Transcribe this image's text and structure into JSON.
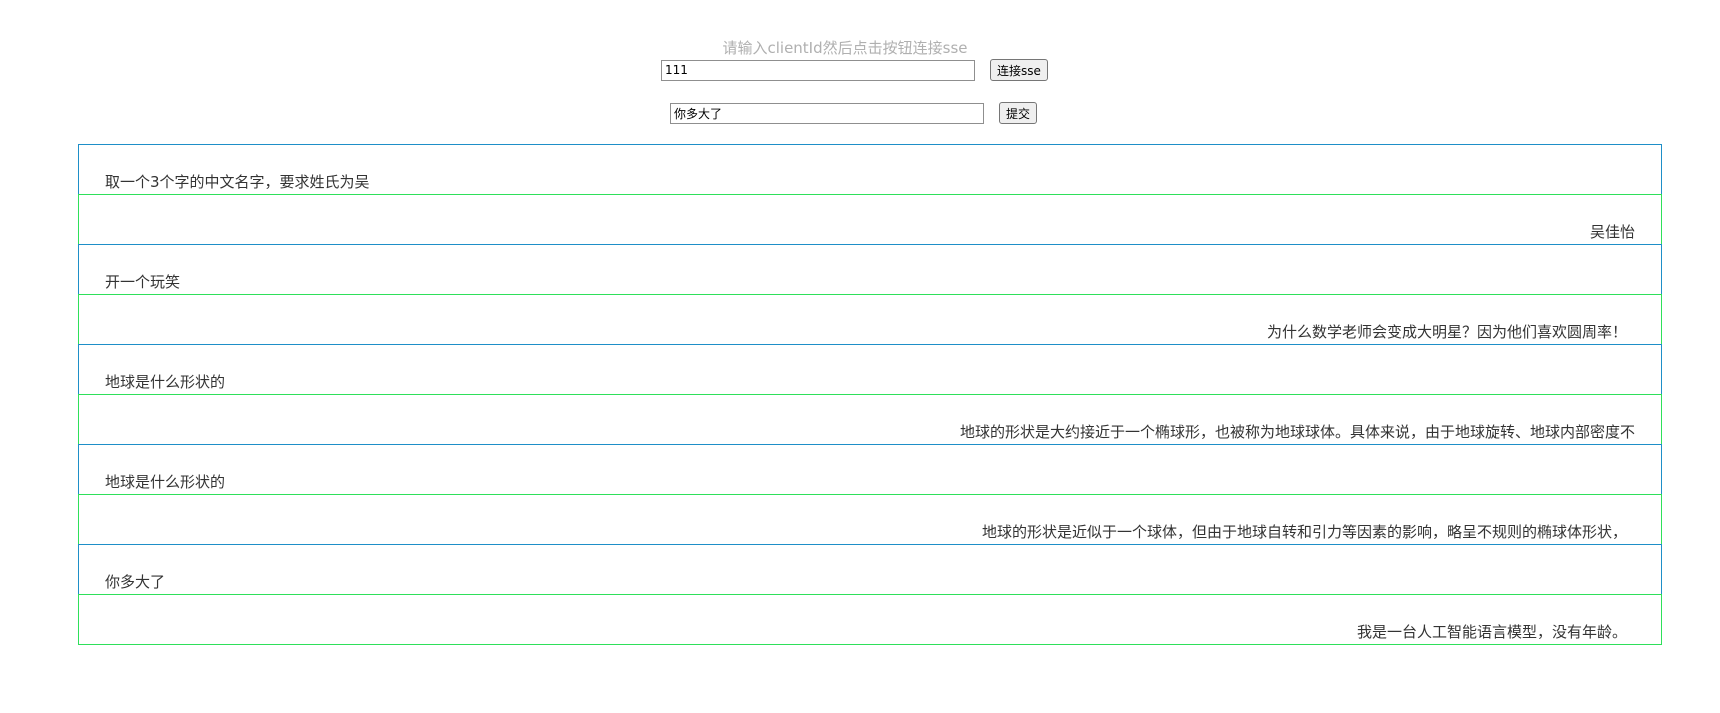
{
  "connect": {
    "hint": "请输入clientId然后点击按钮连接sse",
    "client_id_value": "111",
    "connect_label": "连接sse"
  },
  "ask": {
    "question_value": "你多大了",
    "submit_label": "提交"
  },
  "messages": [
    {
      "role": "user",
      "text": "取一个3个字的中文名字，要求姓氏为吴"
    },
    {
      "role": "bot",
      "text": "吴佳怡"
    },
    {
      "role": "user",
      "text": "开一个玩笑"
    },
    {
      "role": "bot",
      "text": "为什么数学老师会变成大明星？因为他们喜欢圆周率！"
    },
    {
      "role": "user",
      "text": "地球是什么形状的"
    },
    {
      "role": "bot",
      "text": "地球的形状是大约接近于一个椭球形，也被称为地球球体。具体来说，由于地球旋转、地球内部密度不"
    },
    {
      "role": "user",
      "text": "地球是什么形状的"
    },
    {
      "role": "bot",
      "text": "地球的形状是近似于一个球体，但由于地球自转和引力等因素的影响，略呈不规则的椭球体形状，"
    },
    {
      "role": "user",
      "text": "你多大了"
    },
    {
      "role": "bot",
      "text": "我是一台人工智能语言模型，没有年龄。"
    }
  ],
  "colors": {
    "user_border": "#1e8fc8",
    "bot_border": "#2ee05a",
    "hint_text": "#b0b0b0"
  }
}
